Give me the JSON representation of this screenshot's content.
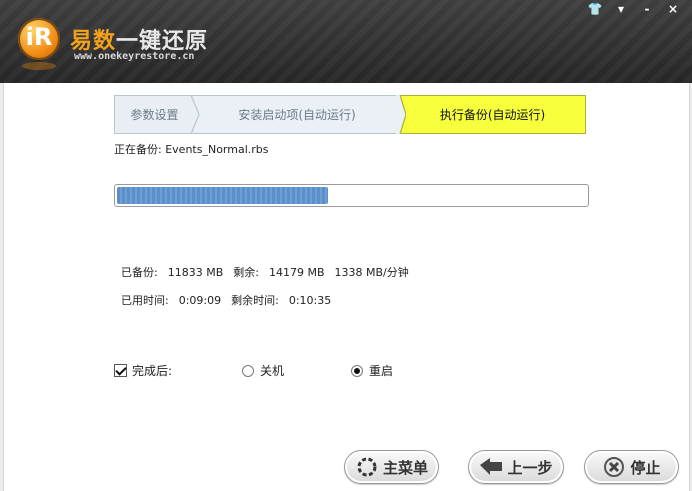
{
  "app": {
    "name_part1": "易数",
    "name_part2": "一键还原",
    "url": "www.onekeyrestore.cn",
    "logo_icon": "logo-icon"
  },
  "window_controls": [
    {
      "name": "skin-icon",
      "glyph": "👕"
    },
    {
      "name": "menu-icon",
      "glyph": "▾"
    },
    {
      "name": "minimize-icon",
      "glyph": "-"
    },
    {
      "name": "close-icon",
      "glyph": "×"
    }
  ],
  "steps": {
    "step1": "参数设置",
    "step2": "安装启动项(自动运行)",
    "step3": "执行备份(自动运行)",
    "active_color": "#f7ff3c"
  },
  "status": {
    "current_label": "正在备份:",
    "current_file": "Events_Normal.rbs",
    "progress": 0.45
  },
  "stats": {
    "backed_label": "已备份:",
    "backed_value": "11833 MB",
    "remain_label": "剩余:",
    "remain_value": "14179 MB",
    "speed": "1338 MB/分钟",
    "elapsed_label": "已用时间:",
    "elapsed_value": "0:09:09",
    "remaining_time_label": "剩余时间:",
    "remaining_time_value": "0:10:35"
  },
  "completion": {
    "checkbox_label": "完成后:",
    "checked": true,
    "shutdown_label": "关机",
    "restart_label": "重启",
    "selected": "restart"
  },
  "buttons": {
    "main_menu": "主菜单",
    "previous": "上一步",
    "stop": "停止"
  }
}
